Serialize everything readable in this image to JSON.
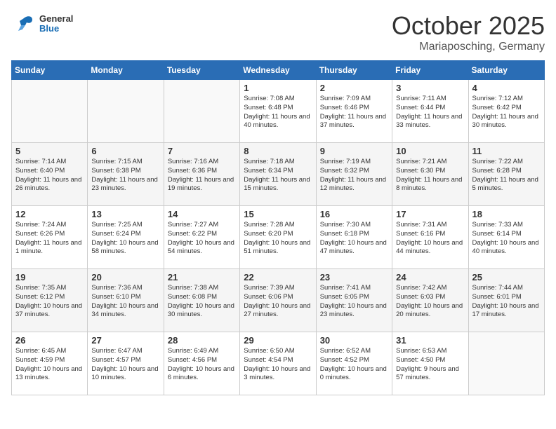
{
  "header": {
    "logo_general": "General",
    "logo_blue": "Blue",
    "title": "October 2025",
    "location": "Mariaposching, Germany"
  },
  "weekdays": [
    "Sunday",
    "Monday",
    "Tuesday",
    "Wednesday",
    "Thursday",
    "Friday",
    "Saturday"
  ],
  "weeks": [
    [
      {
        "day": "",
        "text": ""
      },
      {
        "day": "",
        "text": ""
      },
      {
        "day": "",
        "text": ""
      },
      {
        "day": "1",
        "text": "Sunrise: 7:08 AM\nSunset: 6:48 PM\nDaylight: 11 hours and 40 minutes."
      },
      {
        "day": "2",
        "text": "Sunrise: 7:09 AM\nSunset: 6:46 PM\nDaylight: 11 hours and 37 minutes."
      },
      {
        "day": "3",
        "text": "Sunrise: 7:11 AM\nSunset: 6:44 PM\nDaylight: 11 hours and 33 minutes."
      },
      {
        "day": "4",
        "text": "Sunrise: 7:12 AM\nSunset: 6:42 PM\nDaylight: 11 hours and 30 minutes."
      }
    ],
    [
      {
        "day": "5",
        "text": "Sunrise: 7:14 AM\nSunset: 6:40 PM\nDaylight: 11 hours and 26 minutes."
      },
      {
        "day": "6",
        "text": "Sunrise: 7:15 AM\nSunset: 6:38 PM\nDaylight: 11 hours and 23 minutes."
      },
      {
        "day": "7",
        "text": "Sunrise: 7:16 AM\nSunset: 6:36 PM\nDaylight: 11 hours and 19 minutes."
      },
      {
        "day": "8",
        "text": "Sunrise: 7:18 AM\nSunset: 6:34 PM\nDaylight: 11 hours and 15 minutes."
      },
      {
        "day": "9",
        "text": "Sunrise: 7:19 AM\nSunset: 6:32 PM\nDaylight: 11 hours and 12 minutes."
      },
      {
        "day": "10",
        "text": "Sunrise: 7:21 AM\nSunset: 6:30 PM\nDaylight: 11 hours and 8 minutes."
      },
      {
        "day": "11",
        "text": "Sunrise: 7:22 AM\nSunset: 6:28 PM\nDaylight: 11 hours and 5 minutes."
      }
    ],
    [
      {
        "day": "12",
        "text": "Sunrise: 7:24 AM\nSunset: 6:26 PM\nDaylight: 11 hours and 1 minute."
      },
      {
        "day": "13",
        "text": "Sunrise: 7:25 AM\nSunset: 6:24 PM\nDaylight: 10 hours and 58 minutes."
      },
      {
        "day": "14",
        "text": "Sunrise: 7:27 AM\nSunset: 6:22 PM\nDaylight: 10 hours and 54 minutes."
      },
      {
        "day": "15",
        "text": "Sunrise: 7:28 AM\nSunset: 6:20 PM\nDaylight: 10 hours and 51 minutes."
      },
      {
        "day": "16",
        "text": "Sunrise: 7:30 AM\nSunset: 6:18 PM\nDaylight: 10 hours and 47 minutes."
      },
      {
        "day": "17",
        "text": "Sunrise: 7:31 AM\nSunset: 6:16 PM\nDaylight: 10 hours and 44 minutes."
      },
      {
        "day": "18",
        "text": "Sunrise: 7:33 AM\nSunset: 6:14 PM\nDaylight: 10 hours and 40 minutes."
      }
    ],
    [
      {
        "day": "19",
        "text": "Sunrise: 7:35 AM\nSunset: 6:12 PM\nDaylight: 10 hours and 37 minutes."
      },
      {
        "day": "20",
        "text": "Sunrise: 7:36 AM\nSunset: 6:10 PM\nDaylight: 10 hours and 34 minutes."
      },
      {
        "day": "21",
        "text": "Sunrise: 7:38 AM\nSunset: 6:08 PM\nDaylight: 10 hours and 30 minutes."
      },
      {
        "day": "22",
        "text": "Sunrise: 7:39 AM\nSunset: 6:06 PM\nDaylight: 10 hours and 27 minutes."
      },
      {
        "day": "23",
        "text": "Sunrise: 7:41 AM\nSunset: 6:05 PM\nDaylight: 10 hours and 23 minutes."
      },
      {
        "day": "24",
        "text": "Sunrise: 7:42 AM\nSunset: 6:03 PM\nDaylight: 10 hours and 20 minutes."
      },
      {
        "day": "25",
        "text": "Sunrise: 7:44 AM\nSunset: 6:01 PM\nDaylight: 10 hours and 17 minutes."
      }
    ],
    [
      {
        "day": "26",
        "text": "Sunrise: 6:45 AM\nSunset: 4:59 PM\nDaylight: 10 hours and 13 minutes."
      },
      {
        "day": "27",
        "text": "Sunrise: 6:47 AM\nSunset: 4:57 PM\nDaylight: 10 hours and 10 minutes."
      },
      {
        "day": "28",
        "text": "Sunrise: 6:49 AM\nSunset: 4:56 PM\nDaylight: 10 hours and 6 minutes."
      },
      {
        "day": "29",
        "text": "Sunrise: 6:50 AM\nSunset: 4:54 PM\nDaylight: 10 hours and 3 minutes."
      },
      {
        "day": "30",
        "text": "Sunrise: 6:52 AM\nSunset: 4:52 PM\nDaylight: 10 hours and 0 minutes."
      },
      {
        "day": "31",
        "text": "Sunrise: 6:53 AM\nSunset: 4:50 PM\nDaylight: 9 hours and 57 minutes."
      },
      {
        "day": "",
        "text": ""
      }
    ]
  ]
}
